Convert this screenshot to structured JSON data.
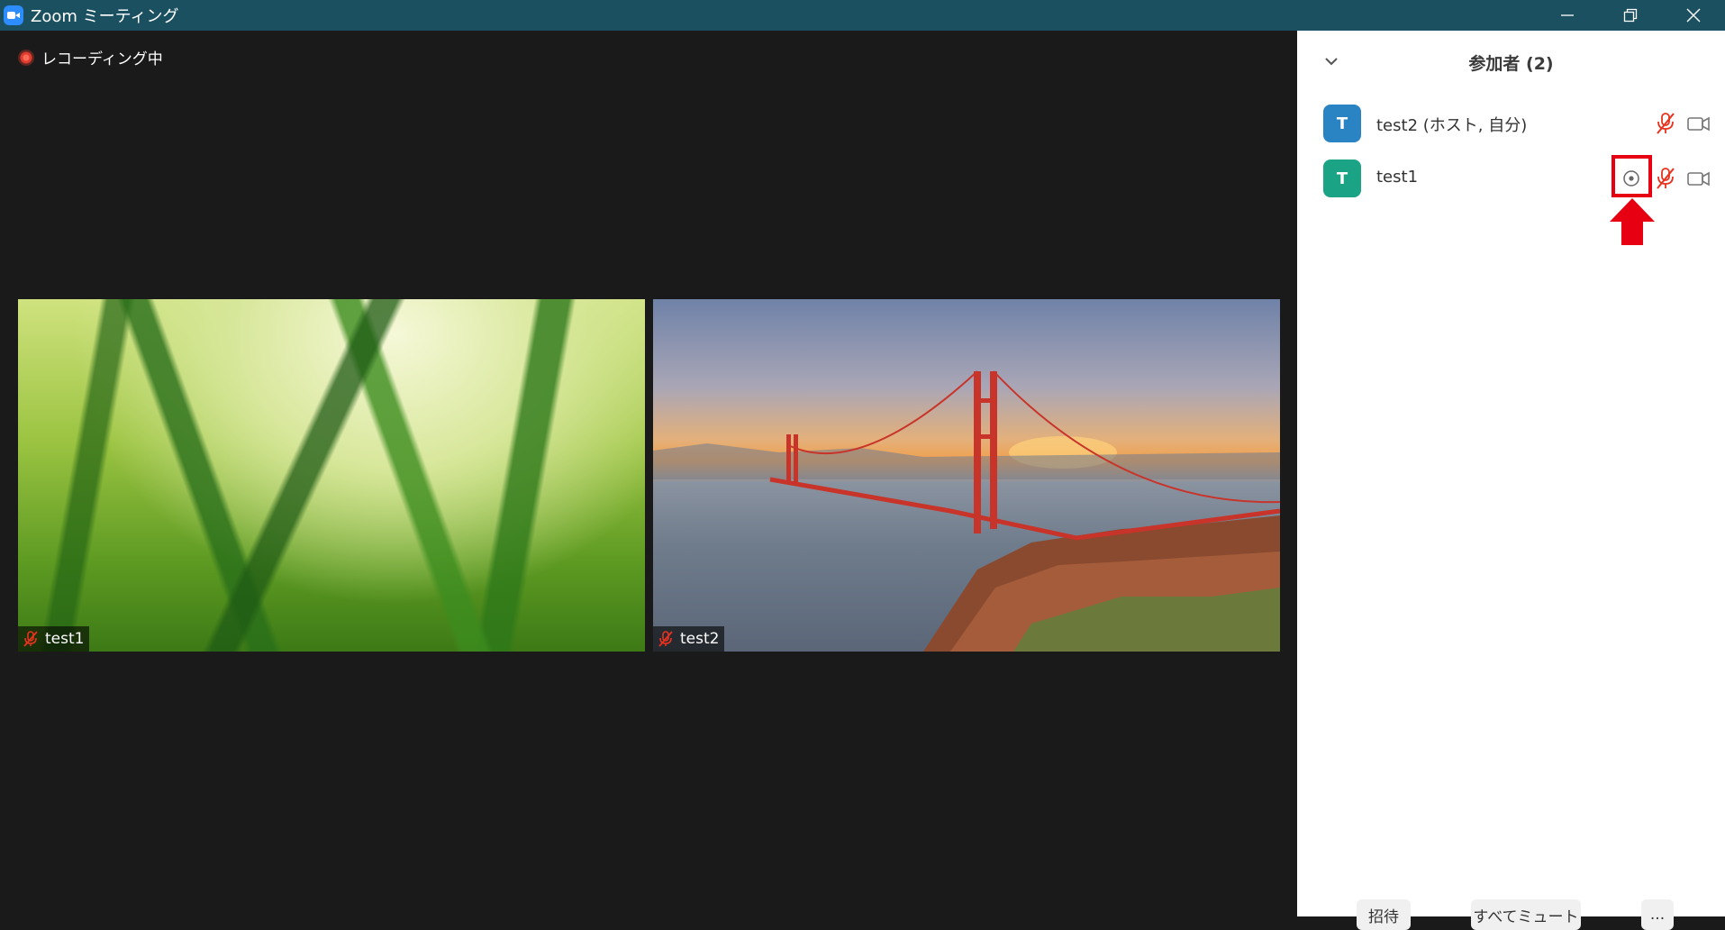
{
  "window": {
    "title": "Zoom ミーティング",
    "icons": {
      "app": "zoom-logo-icon",
      "minimize": "minimize-icon",
      "restore": "restore-icon",
      "close": "close-icon"
    }
  },
  "meeting": {
    "recording_label": "レコーディング中",
    "tiles": [
      {
        "name": "test1",
        "muted": true
      },
      {
        "name": "test2",
        "muted": true
      }
    ]
  },
  "participants_panel": {
    "title": "参加者 (2)",
    "participants": [
      {
        "initial": "T",
        "name": "test2 (ホスト, 自分)",
        "avatar_color": "#2a84c4",
        "muted": true,
        "video_off": true
      },
      {
        "initial": "T",
        "name": "test1",
        "avatar_color": "#1aa384",
        "recording": true,
        "muted": true,
        "video_off": true
      }
    ],
    "buttons": {
      "invite": "招待",
      "mute_all": "すべてミュート",
      "more": "..."
    }
  },
  "colors": {
    "titlebar": "#1b5060",
    "muted_red": "#e8321e",
    "annotation_red": "#e60012"
  }
}
